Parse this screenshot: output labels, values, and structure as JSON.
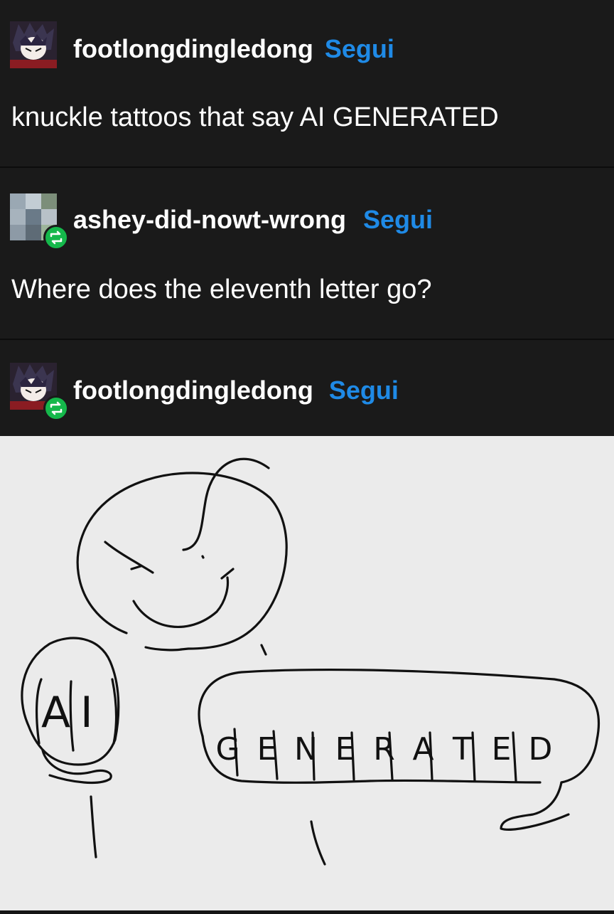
{
  "posts": [
    {
      "username": "footlongdingledong",
      "follow": "Segui",
      "text": "knuckle tattoos that say AI GENERATED"
    },
    {
      "username": "ashey-did-nowt-wrong",
      "follow": "Segui",
      "text": "Where does the eleventh letter go?"
    },
    {
      "username": "footlongdingledong",
      "follow": "Segui"
    }
  ],
  "drawing": {
    "left_fist": "AI",
    "right_fist_letters": [
      "G",
      "E",
      "N",
      "E",
      "R",
      "A",
      "T",
      "E",
      "D"
    ]
  },
  "colors": {
    "background": "#1a1a1a",
    "follow": "#1f8ae6",
    "reblog": "#15b84b",
    "paper": "#ebebeb"
  }
}
